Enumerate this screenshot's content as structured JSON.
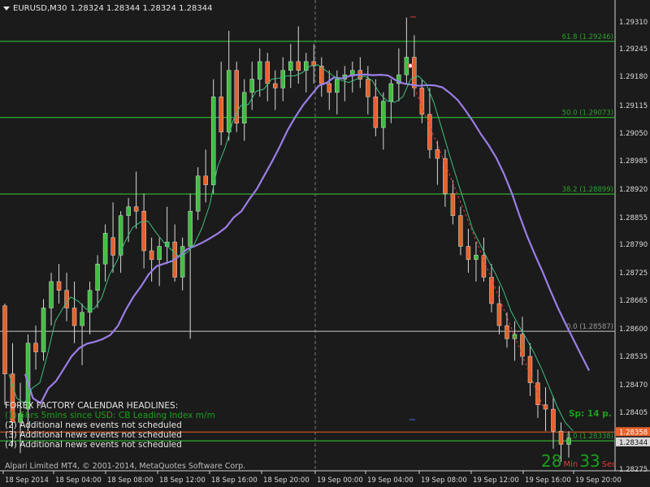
{
  "header": {
    "symbol_timeframe": "EURUSD,M30",
    "ohlc": "1.28324 1.28344 1.28324 1.28344"
  },
  "price_axis": {
    "labels": [
      "1.29310",
      "1.29245",
      "1.29180",
      "1.29115",
      "1.29050",
      "1.28985",
      "1.28920",
      "1.28855",
      "1.28790",
      "1.28725",
      "1.28665",
      "1.28600",
      "1.28535",
      "1.28470",
      "1.28405",
      "1.28275"
    ],
    "current_bid": "1.28344",
    "current_ask": "1.28358"
  },
  "time_axis": {
    "labels": [
      "18 Sep 2014",
      "18 Sep 04:00",
      "18 Sep 08:00",
      "18 Sep 12:00",
      "18 Sep 16:00",
      "18 Sep 20:00",
      "19 Sep 00:00",
      "19 Sep 04:00",
      "19 Sep 08:00",
      "19 Sep 12:00",
      "19 Sep 16:00",
      "19 Sep 20:00"
    ]
  },
  "fibonacci": [
    {
      "label": "61.8 (1.29246)",
      "value": 1.29246
    },
    {
      "label": "50.0 (1.29073)",
      "value": 1.29073
    },
    {
      "label": "38.2 (1.28899)",
      "value": 1.28899
    },
    {
      "label": "0.0 (1.28587)",
      "value": 1.28587
    },
    {
      "label": "0.0 (1.28338)",
      "value": 1.28338
    }
  ],
  "news": {
    "title": "FOREX FACTORY CALENDAR HEADLINES:",
    "items": [
      "(1)  5hrs 5mins since USD: CB Leading Index m/m",
      "(2)  Additional news events not scheduled",
      "(3)  Additional news events not scheduled",
      "(4)  Additional news events not scheduled"
    ]
  },
  "spread": "Sp: 14 p.",
  "countdown": {
    "minutes": "28",
    "min_label": "Min",
    "seconds": "33",
    "sec_label": "Sec"
  },
  "copyright": "Alpari Limited MT4, © 2001-2014, MetaQuotes Software Corp.",
  "colors": {
    "background": "#1b1b1b",
    "bull": "#3fbf3f",
    "bear": "#e8622a",
    "fib": "#2da12d",
    "ma_slow": "#9b7ee8",
    "ma_fast": "#3fbf7f",
    "grey_level": "#9a9a9a"
  },
  "chart_data": {
    "type": "candlestick",
    "title": "EURUSD,M30",
    "ylim": [
      1.2827,
      1.2934
    ],
    "candles": [
      [
        1.28645,
        1.2865,
        1.2842,
        1.2849
      ],
      [
        1.2849,
        1.2856,
        1.2833,
        1.2838
      ],
      [
        1.2838,
        1.2847,
        1.2831,
        1.284
      ],
      [
        1.2841,
        1.2858,
        1.2836,
        1.2856
      ],
      [
        1.2856,
        1.286,
        1.285,
        1.2854
      ],
      [
        1.2854,
        1.2866,
        1.2852,
        1.2864
      ],
      [
        1.2864,
        1.2872,
        1.286,
        1.287
      ],
      [
        1.287,
        1.2874,
        1.2865,
        1.2868
      ],
      [
        1.2868,
        1.2872,
        1.2861,
        1.2864
      ],
      [
        1.2864,
        1.287,
        1.2856,
        1.286
      ],
      [
        1.286,
        1.2865,
        1.2851,
        1.2863
      ],
      [
        1.2863,
        1.287,
        1.2858,
        1.2868
      ],
      [
        1.2868,
        1.2876,
        1.2864,
        1.2874
      ],
      [
        1.2874,
        1.2883,
        1.287,
        1.2881
      ],
      [
        1.288,
        1.2888,
        1.2872,
        1.2876
      ],
      [
        1.2876,
        1.2886,
        1.2872,
        1.2885
      ],
      [
        1.2885,
        1.2889,
        1.2879,
        1.2887
      ],
      [
        1.2887,
        1.2895,
        1.2882,
        1.2886
      ],
      [
        1.2886,
        1.289,
        1.2873,
        1.2877
      ],
      [
        1.2877,
        1.288,
        1.287,
        1.2875
      ],
      [
        1.2875,
        1.288,
        1.2869,
        1.2878
      ],
      [
        1.2878,
        1.2887,
        1.2874,
        1.2879
      ],
      [
        1.2879,
        1.2883,
        1.287,
        1.2871
      ],
      [
        1.2871,
        1.288,
        1.2868,
        1.2878
      ],
      [
        1.2878,
        1.289,
        1.2857,
        1.2886
      ],
      [
        1.2886,
        1.2896,
        1.2884,
        1.2894
      ],
      [
        1.2894,
        1.29,
        1.2888,
        1.2892
      ],
      [
        1.2892,
        1.2916,
        1.289,
        1.2912
      ],
      [
        1.2912,
        1.292,
        1.2901,
        1.2904
      ],
      [
        1.2904,
        1.2927,
        1.2902,
        1.2918
      ],
      [
        1.2918,
        1.292,
        1.2904,
        1.2906
      ],
      [
        1.2906,
        1.2916,
        1.2902,
        1.2913
      ],
      [
        1.2913,
        1.292,
        1.2909,
        1.2916
      ],
      [
        1.2916,
        1.2923,
        1.2912,
        1.292
      ],
      [
        1.292,
        1.2922,
        1.2911,
        1.2915
      ],
      [
        1.2915,
        1.2918,
        1.2909,
        1.2914
      ],
      [
        1.2914,
        1.2921,
        1.2911,
        1.2918
      ],
      [
        1.2918,
        1.2924,
        1.2914,
        1.292
      ],
      [
        1.292,
        1.2928,
        1.2915,
        1.2918
      ],
      [
        1.2918,
        1.2922,
        1.2913,
        1.292
      ],
      [
        1.292,
        1.2924,
        1.2915,
        1.2919
      ],
      [
        1.2919,
        1.2921,
        1.2912,
        1.2915
      ],
      [
        1.2915,
        1.2918,
        1.2909,
        1.2913
      ],
      [
        1.2913,
        1.2918,
        1.2908,
        1.2916
      ],
      [
        1.2916,
        1.2919,
        1.2911,
        1.2917
      ],
      [
        1.2917,
        1.292,
        1.2913,
        1.2918
      ],
      [
        1.2918,
        1.2921,
        1.2914,
        1.2916
      ],
      [
        1.2916,
        1.2919,
        1.2908,
        1.2912
      ],
      [
        1.2912,
        1.2916,
        1.2903,
        1.2905
      ],
      [
        1.2905,
        1.2913,
        1.29,
        1.2911
      ],
      [
        1.2911,
        1.2916,
        1.2906,
        1.2915
      ],
      [
        1.2915,
        1.2923,
        1.2911,
        1.2917
      ],
      [
        1.2917,
        1.293,
        1.2915,
        1.2921
      ],
      [
        1.2921,
        1.2926,
        1.2912,
        1.2914
      ],
      [
        1.2914,
        1.2916,
        1.2906,
        1.2908
      ],
      [
        1.2908,
        1.2914,
        1.2898,
        1.29
      ],
      [
        1.29,
        1.2902,
        1.2892,
        1.2898
      ],
      [
        1.2898,
        1.29,
        1.2887,
        1.289
      ],
      [
        1.289,
        1.2893,
        1.2883,
        1.2885
      ],
      [
        1.2885,
        1.2887,
        1.2876,
        1.2878
      ],
      [
        1.2878,
        1.2882,
        1.2872,
        1.2875
      ],
      [
        1.2875,
        1.2879,
        1.287,
        1.2876
      ],
      [
        1.2876,
        1.288,
        1.287,
        1.2871
      ],
      [
        1.2871,
        1.2874,
        1.2863,
        1.2865
      ],
      [
        1.2865,
        1.2869,
        1.2858,
        1.286
      ],
      [
        1.286,
        1.2863,
        1.2855,
        1.2857
      ],
      [
        1.2857,
        1.2861,
        1.2852,
        1.2858
      ],
      [
        1.2858,
        1.2862,
        1.2851,
        1.2853
      ],
      [
        1.2853,
        1.2856,
        1.2844,
        1.2847
      ],
      [
        1.2847,
        1.285,
        1.2839,
        1.2842
      ],
      [
        1.2842,
        1.2846,
        1.2836,
        1.2841
      ],
      [
        1.2841,
        1.2844,
        1.2832,
        1.2836
      ],
      [
        1.2836,
        1.2838,
        1.2829,
        1.2833
      ],
      [
        1.2833,
        1.2836,
        1.283,
        1.28344
      ]
    ],
    "moving_averages": [
      {
        "name": "slow MA",
        "color": "#9b7ee8"
      },
      {
        "name": "fast MA",
        "color": "#3fbf7f"
      }
    ]
  }
}
